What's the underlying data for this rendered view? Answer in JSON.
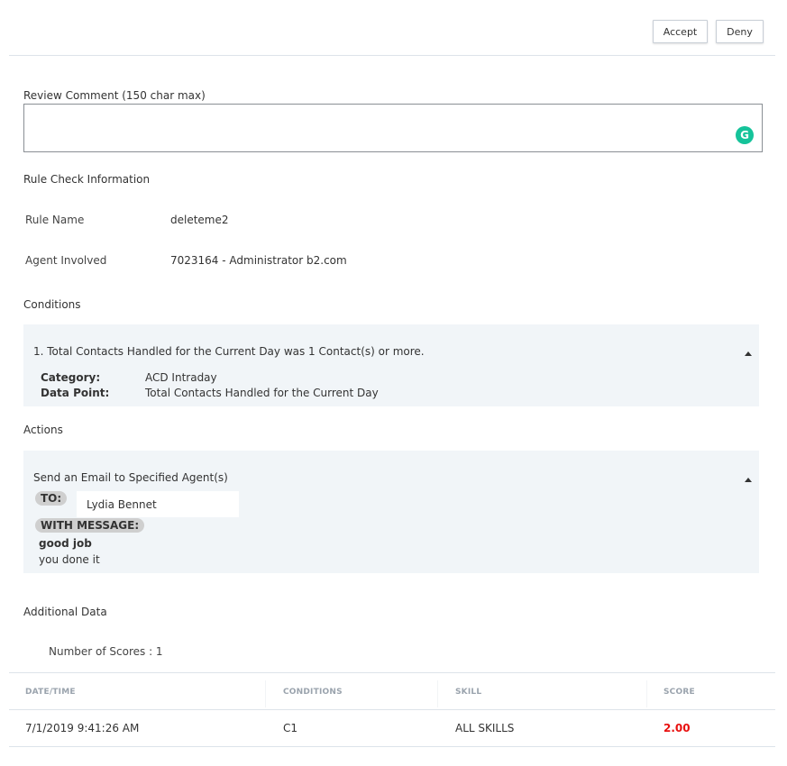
{
  "toolbar": {
    "accept_label": "Accept",
    "deny_label": "Deny"
  },
  "review": {
    "label": "Review Comment (150 char max)",
    "value": "",
    "placeholder": "",
    "grammarly_glyph": "G"
  },
  "rule_check": {
    "title": "Rule Check Information",
    "rule_name_label": "Rule Name",
    "rule_name_value": "deleteme2",
    "agent_label": "Agent Involved",
    "agent_value": "7023164 - Administrator b2.com"
  },
  "conditions": {
    "title": "Conditions",
    "items": [
      {
        "text": "1. Total Contacts Handled for the Current Day was 1 Contact(s) or more.",
        "category_label": "Category:",
        "category_value": "ACD Intraday",
        "datapoint_label": "Data Point:",
        "datapoint_value": "Total Contacts Handled for the Current Day",
        "expanded": true
      }
    ]
  },
  "actions": {
    "title": "Actions",
    "items": [
      {
        "text": "Send an Email to Specified Agent(s)",
        "to_label": "TO:",
        "to_value": "Lydia Bennet",
        "message_label": "WITH MESSAGE:",
        "message_subject": "good job",
        "message_body": "you done it",
        "expanded": true
      }
    ]
  },
  "additional": {
    "title": "Additional Data",
    "scores_count": "Number of Scores : 1"
  },
  "table": {
    "columns": [
      "DATE/TIME",
      "CONDITIONS",
      "SKILL",
      "SCORE"
    ],
    "rows": [
      {
        "datetime": "7/1/2019 9:41:26 AM",
        "conditions": "C1",
        "skill": "ALL SKILLS",
        "score": "2.00"
      }
    ]
  },
  "colors": {
    "score": "#e8100f",
    "panel_bg": "#f1f5f8",
    "grammarly": "#15c39a"
  }
}
